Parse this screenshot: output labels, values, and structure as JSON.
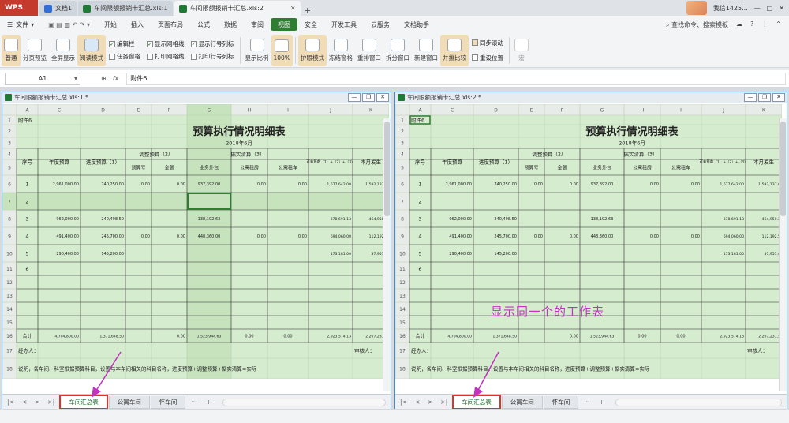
{
  "app": {
    "name": "WPS",
    "tabs": [
      {
        "label": "文档1",
        "active": false
      },
      {
        "label": "车间限额报销卡汇总.xls:1",
        "active": false
      },
      {
        "label": "车间限额报销卡汇总.xls:2",
        "active": true
      }
    ],
    "user": "我信1425..."
  },
  "menu": {
    "file_label": "文件",
    "items": [
      "开始",
      "插入",
      "页面布局",
      "公式",
      "数据",
      "审阅",
      "视图",
      "安全",
      "开发工具",
      "云服务",
      "文档助手"
    ],
    "active": "视图",
    "search_placeholder": "查找命令、搜索模板"
  },
  "ribbon": {
    "normal": "普通",
    "pagebreak": "分页预览",
    "fullscreen": "全屏显示",
    "reading": "阅读模式",
    "checks": [
      {
        "label": "编辑栏",
        "checked": true
      },
      {
        "label": "任务窗格",
        "checked": false
      },
      {
        "label": "显示网格线",
        "checked": true
      },
      {
        "label": "打印网格线",
        "checked": false
      },
      {
        "label": "显示行号列标",
        "checked": true
      },
      {
        "label": "打印行号列标",
        "checked": false
      }
    ],
    "show_ratio": "显示比例",
    "zoom100": "100%",
    "eye_mode": "护眼模式",
    "freeze": "冻结窗格",
    "rearrange": "重排窗口",
    "split": "拆分窗口",
    "newwin": "新建窗口",
    "sidebyside": "并排比较",
    "sync_scroll": "同步滚动",
    "reset_pos": "重设位置",
    "macro": "宏"
  },
  "formula": {
    "cell": "A1",
    "content": "附件6"
  },
  "windows": [
    {
      "title": "车间限额报销卡汇总.xls:1 *",
      "active_tab": "车间汇总表",
      "tabs": [
        "车间汇总表",
        "公寓车间",
        "怀车间"
      ]
    },
    {
      "title": "车间限额报销卡汇总.xls:2 *",
      "active_tab": "车间汇总表",
      "tabs": [
        "车间汇总表",
        "公寓车间",
        "怀车间"
      ]
    }
  ],
  "sheet": {
    "col_headers": [
      "A",
      "C",
      "D",
      "E",
      "F",
      "G",
      "H",
      "I",
      "J",
      "K"
    ],
    "row_headers": [
      "1",
      "2",
      "3",
      "4",
      "5",
      "6",
      "7",
      "8",
      "9",
      "10",
      "11",
      "12",
      "13",
      "14",
      "15",
      "16",
      "17",
      "18"
    ],
    "a1": "附件6",
    "title": "预算执行情况明细表",
    "period": "2018年6月",
    "h_seq": "序号",
    "h_annual": "年度预算",
    "h_progress": "进度预算（1）",
    "h_adjust": "调整预算（2）",
    "h_adj_no": "预算号",
    "h_adj_amt": "金额",
    "h_actual": "据实清算（3）",
    "h_outsource": "业务外包",
    "h_rent_apt": "公寓租房",
    "h_rent_car": "公寓租车",
    "h_available": "可有算数（1）+（2）+（3）",
    "h_month": "本月发生",
    "rows": [
      {
        "seq": "1",
        "annual": "2,961,000.00",
        "progress": "740,250.00",
        "no": "0.00",
        "amt": "0.00",
        "outsrc": "937,392.00",
        "apt": "0.00",
        "car": "0.00",
        "avail": "1,677,642.00",
        "month": "1,592,137.0"
      },
      {
        "seq": "2",
        "annual": "",
        "progress": "",
        "no": "",
        "amt": "",
        "outsrc": "",
        "apt": "",
        "car": "",
        "avail": "",
        "month": ""
      },
      {
        "seq": "3",
        "annual": "962,000.00",
        "progress": "240,498.50",
        "no": "",
        "amt": "",
        "outsrc": "138,192.63",
        "apt": "",
        "car": "",
        "avail": "378,691.13",
        "month": "464,950.2"
      },
      {
        "seq": "4",
        "annual": "491,400.00",
        "progress": "245,700.00",
        "no": "0.00",
        "amt": "0.00",
        "outsrc": "448,360.00",
        "apt": "0.00",
        "car": "0.00",
        "avail": "694,060.00",
        "month": "112,192.5"
      },
      {
        "seq": "5",
        "annual": "290,400.00",
        "progress": "145,200.00",
        "no": "",
        "amt": "",
        "outsrc": "",
        "apt": "",
        "car": "",
        "avail": "173,181.00",
        "month": "37,951.0"
      },
      {
        "seq": "6",
        "annual": "",
        "progress": "",
        "no": "",
        "amt": "",
        "outsrc": "",
        "apt": "",
        "car": "",
        "avail": "",
        "month": ""
      }
    ],
    "total_label": "合计",
    "total": {
      "annual": "4,704,800.00",
      "progress": "1,371,648.50",
      "no": "",
      "amt": "0.00",
      "outsrc": "1,523,944.63",
      "apt": "0.00",
      "car": "0.00",
      "avail": "2,923,574.13",
      "month": "2,207,231.5"
    },
    "handler": "经办人：",
    "reviewer": "审核人：",
    "note": "说明，各车间、科室根据预算科目，设置与本车间相关的科目名称，进度预算+调整预算+据实清算=实际"
  },
  "annotation": "显示同一个的工作表",
  "colors": {
    "accent": "#2e7d32",
    "sheet_fill": "#d5ecce",
    "highlight_red": "#e0342a",
    "annotation": "#c332c3"
  }
}
